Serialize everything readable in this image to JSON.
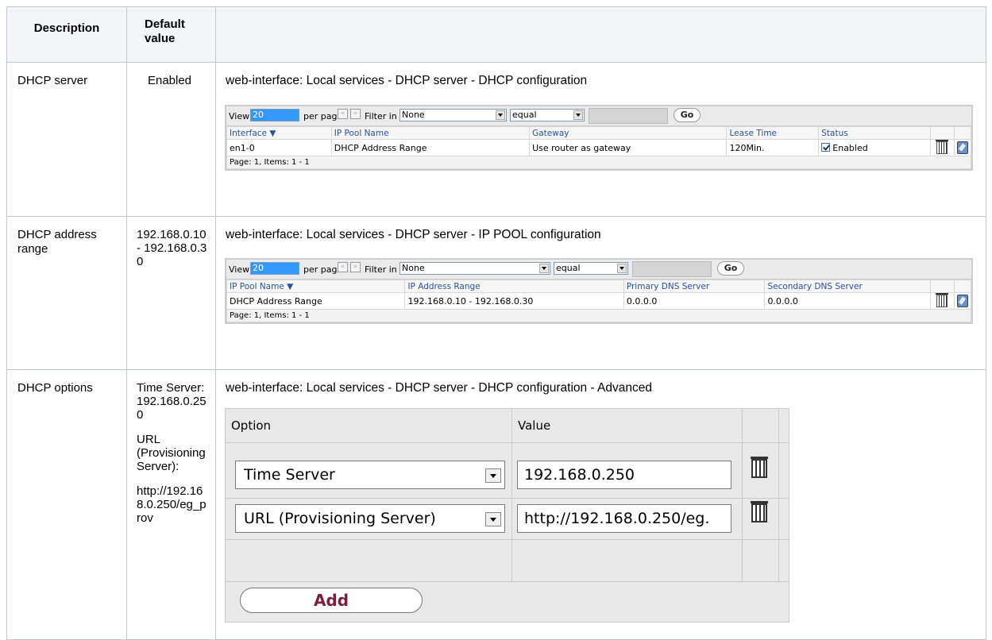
{
  "headers": {
    "description": "Description",
    "default_value": "Default value",
    "content": ""
  },
  "rows": [
    {
      "description": "DHCP server",
      "default": "Enabled",
      "path": "web-interface: Local services - DHCP server - DHCP configuration",
      "grid": {
        "toolbar": {
          "view": "View",
          "per_page_value": "20",
          "per_page": "per page",
          "prev": "«",
          "next": "»",
          "filter_in": "Filter in",
          "filter_value": "None",
          "op_value": "equal",
          "search_value": "",
          "go": "Go"
        },
        "columns": [
          "Interface ▼",
          "IP Pool Name",
          "Gateway",
          "Lease Time",
          "Status",
          "",
          ""
        ],
        "row": {
          "interface": "en1-0",
          "ip_pool_name": "DHCP Address Range",
          "gateway": "Use router as gateway",
          "lease_time": "120Min.",
          "status": "Enabled"
        },
        "footer": "Page:  1, Items:  1 - 1"
      }
    },
    {
      "description": "DHCP address range",
      "default": "192.168.0.10 - 192.168.0.30",
      "path": "web-interface: Local services - DHCP server - IP POOL configuration",
      "grid": {
        "toolbar": {
          "view": "View",
          "per_page_value": "20",
          "per_page": "per page",
          "prev": "«",
          "next": "»",
          "filter_in": "Filter in",
          "filter_value": "None",
          "op_value": "equal",
          "search_value": "",
          "go": "Go"
        },
        "columns": [
          "IP Pool Name ▼",
          "IP Address Range",
          "Primary DNS Server",
          "Secondary DNS Server",
          "",
          ""
        ],
        "row": {
          "ip_pool_name": "DHCP Address Range",
          "ip_address_range": "192.168.0.10 - 192.168.0.30",
          "primary_dns": "0.0.0.0",
          "secondary_dns": "0.0.0.0"
        },
        "footer": "Page:  1, Items:  1 - 1"
      }
    },
    {
      "description": "DHCP options",
      "default_p1": "Time Server: 192.168.0.250",
      "default_p2": "URL (Provisioning Server):",
      "default_p3": "http://192.168.0.250/eg_prov",
      "path": "web-interface: Local services - DHCP server - DHCP configuration - Advanced",
      "options": {
        "col_option": "Option",
        "col_value": "Value",
        "rows": [
          {
            "option": "Time Server",
            "value": "192.168.0.250"
          },
          {
            "option": "URL (Provisioning Server)",
            "value": "http://192.168.0.250/eg."
          }
        ],
        "add": "Add"
      }
    }
  ]
}
